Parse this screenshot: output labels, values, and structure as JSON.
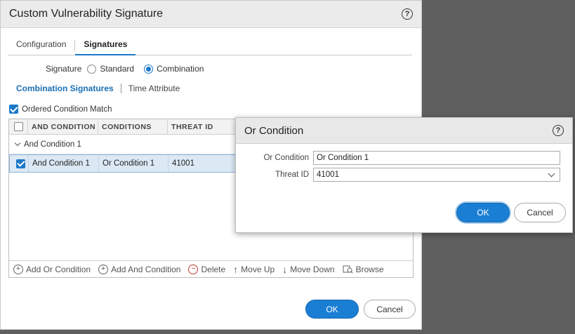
{
  "main": {
    "title": "Custom Vulnerability Signature",
    "tabs": [
      {
        "label": "Configuration",
        "active": false
      },
      {
        "label": "Signatures",
        "active": true
      }
    ],
    "signature": {
      "label": "Signature",
      "options": [
        {
          "label": "Standard",
          "selected": false
        },
        {
          "label": "Combination",
          "selected": true
        }
      ]
    },
    "subtabs": [
      {
        "label": "Combination Signatures",
        "active": true
      },
      {
        "label": "Time Attribute",
        "active": false
      }
    ],
    "ordered_condition_match": {
      "label": "Ordered Condition Match",
      "checked": true
    },
    "table": {
      "columns": [
        "AND CONDITION",
        "CONDITIONS",
        "THREAT ID"
      ],
      "group": "And Condition 1",
      "rows": [
        {
          "and_condition": "And Condition 1",
          "conditions": "Or Condition 1",
          "threat_id": "41001",
          "selected": true
        }
      ]
    },
    "toolbar": {
      "add_or": "Add Or Condition",
      "add_and": "Add And Condition",
      "delete": "Delete",
      "move_up": "Move Up",
      "move_down": "Move Down",
      "browse": "Browse"
    },
    "ok": "OK",
    "cancel": "Cancel"
  },
  "dialog": {
    "title": "Or Condition",
    "or_condition_label": "Or Condition",
    "or_condition_value": "Or Condition 1",
    "threat_id_label": "Threat ID",
    "threat_id_value": "41001",
    "ok": "OK",
    "cancel": "Cancel"
  },
  "help_glyph": "?",
  "colors": {
    "accent": "#1a79c8",
    "primary_button": "#1a7fd4",
    "backdrop": "#5f5f5f",
    "selected_row": "#dce9f5"
  }
}
